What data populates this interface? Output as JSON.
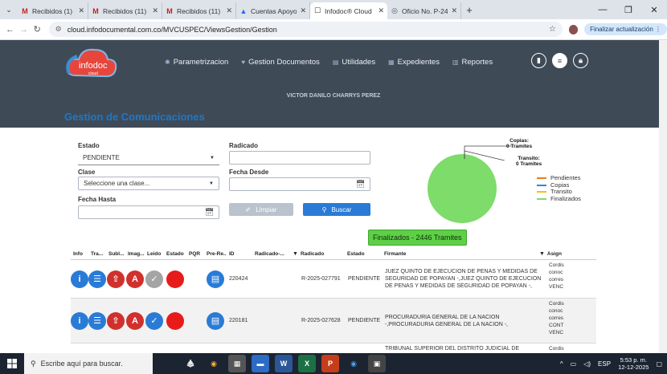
{
  "browser": {
    "tabs": [
      {
        "icon": "gmail-icon",
        "title": "Recibidos (1) - danil",
        "active": false,
        "color": "#c5221f"
      },
      {
        "icon": "gmail-icon",
        "title": "Recibidos (11) - victo",
        "active": false,
        "color": "#c5221f"
      },
      {
        "icon": "gmail-icon",
        "title": "Recibidos (11) - insun",
        "active": false,
        "color": "#c5221f"
      },
      {
        "icon": "drive-icon",
        "title": "Cuentas Apoyo Supe",
        "active": false,
        "color": "#1a73e8"
      },
      {
        "icon": "infodoc-icon",
        "title": "Infodoc® Cloud",
        "active": true,
        "color": "#333333"
      },
      {
        "icon": "globe-icon",
        "title": "Oficio No. P-2408 -2",
        "active": false,
        "color": "#555555"
      }
    ],
    "url": "cloud.infodocumental.com.co/MVCUSPEC/ViewsGestion/Gestion",
    "update_label": "Finalizar actualización"
  },
  "app": {
    "logo_text": "infodoc",
    "logo_sub": "cloud",
    "nav": [
      {
        "label": "Parametrizacion"
      },
      {
        "label": "Gestion Documentos"
      },
      {
        "label": "Utilidades"
      },
      {
        "label": "Expedientes"
      },
      {
        "label": "Reportes"
      }
    ],
    "user": "VICTOR DANILO CHARRYS PEREZ",
    "page_title": "Gestion de Comunicaciones"
  },
  "form": {
    "estado_label": "Estado",
    "estado_value": "PENDIENTE",
    "clase_label": "Clase",
    "clase_placeholder": "Seleccione una clase...",
    "fecha_hasta_label": "Fecha Hasta",
    "radicado_label": "Radicado",
    "fecha_desde_label": "Fecha Desde",
    "limpiar_label": "Limpiar",
    "buscar_label": "Buscar"
  },
  "chart_data": {
    "type": "pie",
    "categories": [
      "Pendientes",
      "Copias",
      "Transito",
      "Finalizados"
    ],
    "values": [
      0,
      0,
      0,
      2446
    ],
    "colors": [
      "#e67e22",
      "#2e86de",
      "#f1c40f",
      "#7ddc6a"
    ],
    "legend": "right",
    "annotations": [
      {
        "text": "Copias:\n0 Tramites"
      },
      {
        "text": "Transito:\n0 Tramites"
      }
    ],
    "tooltip": "Finalizados - 2446 Tramites"
  },
  "table": {
    "headers": [
      "Info",
      "Tra...",
      "Subl...",
      "Imag...",
      "Leido",
      "Estado",
      "PQR",
      "Pre-Re...",
      "ID",
      "Radicado-...",
      "Radicado",
      "Estado",
      "Firmante",
      "Asign"
    ],
    "rows": [
      {
        "id": "220424",
        "radicado": "R-2025-027791",
        "estado": "PENDIENTE",
        "firmante": "JUEZ QUINTO DE EJECUCION DE PENAS Y MEDIDAS DE SEGURIDAD DE POPAYAN -,JUEZ QUINTO DE EJECUCION DE PENAS Y MEDIDAS DE SEGURIDAD DE POPAYAN -,",
        "asign": "Cordis conoc corres VENC"
      },
      {
        "id": "220181",
        "radicado": "R-2025-027628",
        "estado": "PENDIENTE",
        "firmante": "PROCURADURIA GENERAL DE LA NACION -,PROCURADURIA GENERAL DE LA NACION -,",
        "asign": "Cordis conoc corres CONT VENC"
      },
      {
        "id": "",
        "radicado": "",
        "estado": "",
        "firmante": "TRIBUNAL SUPERIOR DEL DISTRITO JUDICIAL DE",
        "asign": "Cordis"
      }
    ]
  },
  "taskbar": {
    "search_placeholder": "Escribe aquí para buscar.",
    "lang": "ESP",
    "time": "5:53 p. m.",
    "date": "12-12-2025"
  }
}
